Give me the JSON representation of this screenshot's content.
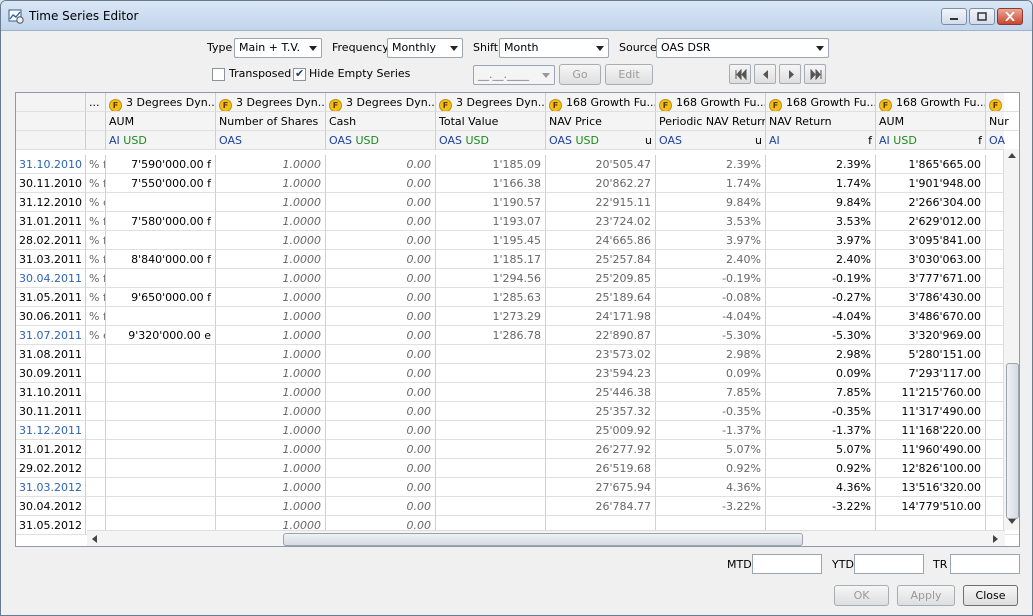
{
  "window": {
    "title": "Time Series Editor"
  },
  "toolbar": {
    "type_label": "Type",
    "type_value": "Main + T.V.",
    "frequency_label": "Frequency",
    "frequency_value": "Monthly",
    "shift_label": "Shift",
    "shift_value": "Month",
    "source_label": "Source",
    "source_value": "OAS DSR",
    "transposed_label": "Transposed",
    "transposed_checked": false,
    "hide_empty_label": "Hide Empty Series",
    "hide_empty_checked": true,
    "date_placeholder": "__.__.____",
    "go_label": "Go",
    "edit_label": "Edit"
  },
  "grid": {
    "columns": [
      {
        "fund": "...",
        "field": "",
        "source": "",
        "currency": "",
        "flag": ""
      },
      {
        "fund": "3 Degrees Dyn...",
        "field": "AUM",
        "source": "AI",
        "currency": "USD",
        "flag": ""
      },
      {
        "fund": "3 Degrees Dyn...",
        "field": "Number of Shares",
        "source": "OAS",
        "currency": "",
        "flag": ""
      },
      {
        "fund": "3 Degrees Dyn...",
        "field": "Cash",
        "source": "OAS",
        "currency": "USD",
        "flag": ""
      },
      {
        "fund": "3 Degrees Dyn...",
        "field": "Total Value",
        "source": "OAS",
        "currency": "USD",
        "flag": ""
      },
      {
        "fund": "168 Growth Fu...",
        "field": "NAV Price",
        "source": "OAS",
        "currency": "USD",
        "flag": "u"
      },
      {
        "fund": "168 Growth Fu...",
        "field": "Periodic NAV Return",
        "source": "OAS",
        "currency": "",
        "flag": "u"
      },
      {
        "fund": "168 Growth Fu...",
        "field": "NAV Return",
        "source": "AI",
        "currency": "",
        "flag": "f"
      },
      {
        "fund": "168 Growth Fu...",
        "field": "AUM",
        "source": "AI",
        "currency": "USD",
        "flag": "f"
      },
      {
        "fund": "",
        "field": "Nur",
        "source": "OA",
        "currency": "",
        "flag": ""
      }
    ],
    "rows": [
      {
        "date": "31.10.2010",
        "blue": true,
        "c0": "% f",
        "aum": "7'590'000.00 f",
        "shares": "1.0000",
        "cash": "0.00",
        "tv": "1'185.09",
        "nav": "20'505.47",
        "pret": "2.39%",
        "ret": "2.39%",
        "aum2": "1'865'665.00"
      },
      {
        "date": "30.11.2010",
        "blue": false,
        "c0": "% f",
        "aum": "7'550'000.00 f",
        "shares": "1.0000",
        "cash": "0.00",
        "tv": "1'166.38",
        "nav": "20'862.27",
        "pret": "1.74%",
        "ret": "1.74%",
        "aum2": "1'901'948.00"
      },
      {
        "date": "31.12.2010",
        "blue": false,
        "c0": "% e",
        "aum": "",
        "shares": "1.0000",
        "cash": "0.00",
        "tv": "1'190.57",
        "nav": "22'915.11",
        "pret": "9.84%",
        "ret": "9.84%",
        "aum2": "2'266'304.00"
      },
      {
        "date": "31.01.2011",
        "blue": false,
        "c0": "% f",
        "aum": "7'580'000.00 f",
        "shares": "1.0000",
        "cash": "0.00",
        "tv": "1'193.07",
        "nav": "23'724.02",
        "pret": "3.53%",
        "ret": "3.53%",
        "aum2": "2'629'012.00"
      },
      {
        "date": "28.02.2011",
        "blue": false,
        "c0": "% f",
        "aum": "",
        "shares": "1.0000",
        "cash": "0.00",
        "tv": "1'195.45",
        "nav": "24'665.86",
        "pret": "3.97%",
        "ret": "3.97%",
        "aum2": "3'095'841.00"
      },
      {
        "date": "31.03.2011",
        "blue": false,
        "c0": "% f",
        "aum": "8'840'000.00 f",
        "shares": "1.0000",
        "cash": "0.00",
        "tv": "1'185.17",
        "nav": "25'257.84",
        "pret": "2.40%",
        "ret": "2.40%",
        "aum2": "3'030'063.00"
      },
      {
        "date": "30.04.2011",
        "blue": true,
        "c0": "% f",
        "aum": "",
        "shares": "1.0000",
        "cash": "0.00",
        "tv": "1'294.56",
        "nav": "25'209.85",
        "pret": "-0.19%",
        "ret": "-0.19%",
        "aum2": "3'777'671.00"
      },
      {
        "date": "31.05.2011",
        "blue": false,
        "c0": "% f",
        "aum": "9'650'000.00 f",
        "shares": "1.0000",
        "cash": "0.00",
        "tv": "1'285.63",
        "nav": "25'189.64",
        "pret": "-0.08%",
        "ret": "-0.27%",
        "aum2": "3'786'430.00"
      },
      {
        "date": "30.06.2011",
        "blue": false,
        "c0": "% f",
        "aum": "",
        "shares": "1.0000",
        "cash": "0.00",
        "tv": "1'273.29",
        "nav": "24'171.98",
        "pret": "-4.04%",
        "ret": "-4.04%",
        "aum2": "3'486'670.00"
      },
      {
        "date": "31.07.2011",
        "blue": true,
        "c0": "% e",
        "aum": "9'320'000.00 e",
        "shares": "1.0000",
        "cash": "0.00",
        "tv": "1'286.78",
        "nav": "22'890.87",
        "pret": "-5.30%",
        "ret": "-5.30%",
        "aum2": "3'320'969.00"
      },
      {
        "date": "31.08.2011",
        "blue": false,
        "c0": "",
        "aum": "",
        "shares": "1.0000",
        "cash": "0.00",
        "tv": "",
        "nav": "23'573.02",
        "pret": "2.98%",
        "ret": "2.98%",
        "aum2": "5'280'151.00"
      },
      {
        "date": "30.09.2011",
        "blue": false,
        "c0": "",
        "aum": "",
        "shares": "1.0000",
        "cash": "0.00",
        "tv": "",
        "nav": "23'594.23",
        "pret": "0.09%",
        "ret": "0.09%",
        "aum2": "7'293'117.00"
      },
      {
        "date": "31.10.2011",
        "blue": false,
        "c0": "",
        "aum": "",
        "shares": "1.0000",
        "cash": "0.00",
        "tv": "",
        "nav": "25'446.38",
        "pret": "7.85%",
        "ret": "7.85%",
        "aum2": "11'215'760.00"
      },
      {
        "date": "30.11.2011",
        "blue": false,
        "c0": "",
        "aum": "",
        "shares": "1.0000",
        "cash": "0.00",
        "tv": "",
        "nav": "25'357.32",
        "pret": "-0.35%",
        "ret": "-0.35%",
        "aum2": "11'317'490.00"
      },
      {
        "date": "31.12.2011",
        "blue": true,
        "c0": "",
        "aum": "",
        "shares": "1.0000",
        "cash": "0.00",
        "tv": "",
        "nav": "25'009.92",
        "pret": "-1.37%",
        "ret": "-1.37%",
        "aum2": "11'168'220.00"
      },
      {
        "date": "31.01.2012",
        "blue": false,
        "c0": "",
        "aum": "",
        "shares": "1.0000",
        "cash": "0.00",
        "tv": "",
        "nav": "26'277.92",
        "pret": "5.07%",
        "ret": "5.07%",
        "aum2": "11'960'490.00"
      },
      {
        "date": "29.02.2012",
        "blue": false,
        "c0": "",
        "aum": "",
        "shares": "1.0000",
        "cash": "0.00",
        "tv": "",
        "nav": "26'519.68",
        "pret": "0.92%",
        "ret": "0.92%",
        "aum2": "12'826'100.00"
      },
      {
        "date": "31.03.2012",
        "blue": true,
        "c0": "",
        "aum": "",
        "shares": "1.0000",
        "cash": "0.00",
        "tv": "",
        "nav": "27'675.94",
        "pret": "4.36%",
        "ret": "4.36%",
        "aum2": "13'516'320.00"
      },
      {
        "date": "30.04.2012",
        "blue": false,
        "c0": "",
        "aum": "",
        "shares": "1.0000",
        "cash": "0.00",
        "tv": "",
        "nav": "26'784.77",
        "pret": "-3.22%",
        "ret": "-3.22%",
        "aum2": "14'779'510.00"
      },
      {
        "date": "31.05.2012",
        "blue": false,
        "c0": "",
        "aum": "",
        "shares": "1.0000",
        "cash": "0.00",
        "tv": "",
        "nav": "",
        "pret": "",
        "ret": "",
        "aum2": ""
      }
    ]
  },
  "footer": {
    "mtd_label": "MTD",
    "ytd_label": "YTD",
    "tr_label": "TR",
    "ok_label": "OK",
    "apply_label": "Apply",
    "close_label": "Close"
  },
  "colors": {
    "date_blue": "#2b64b5",
    "source_blue": "#1d3fa3",
    "currency_green": "#1b8a1b",
    "fund_icon": "#f2bd16"
  }
}
